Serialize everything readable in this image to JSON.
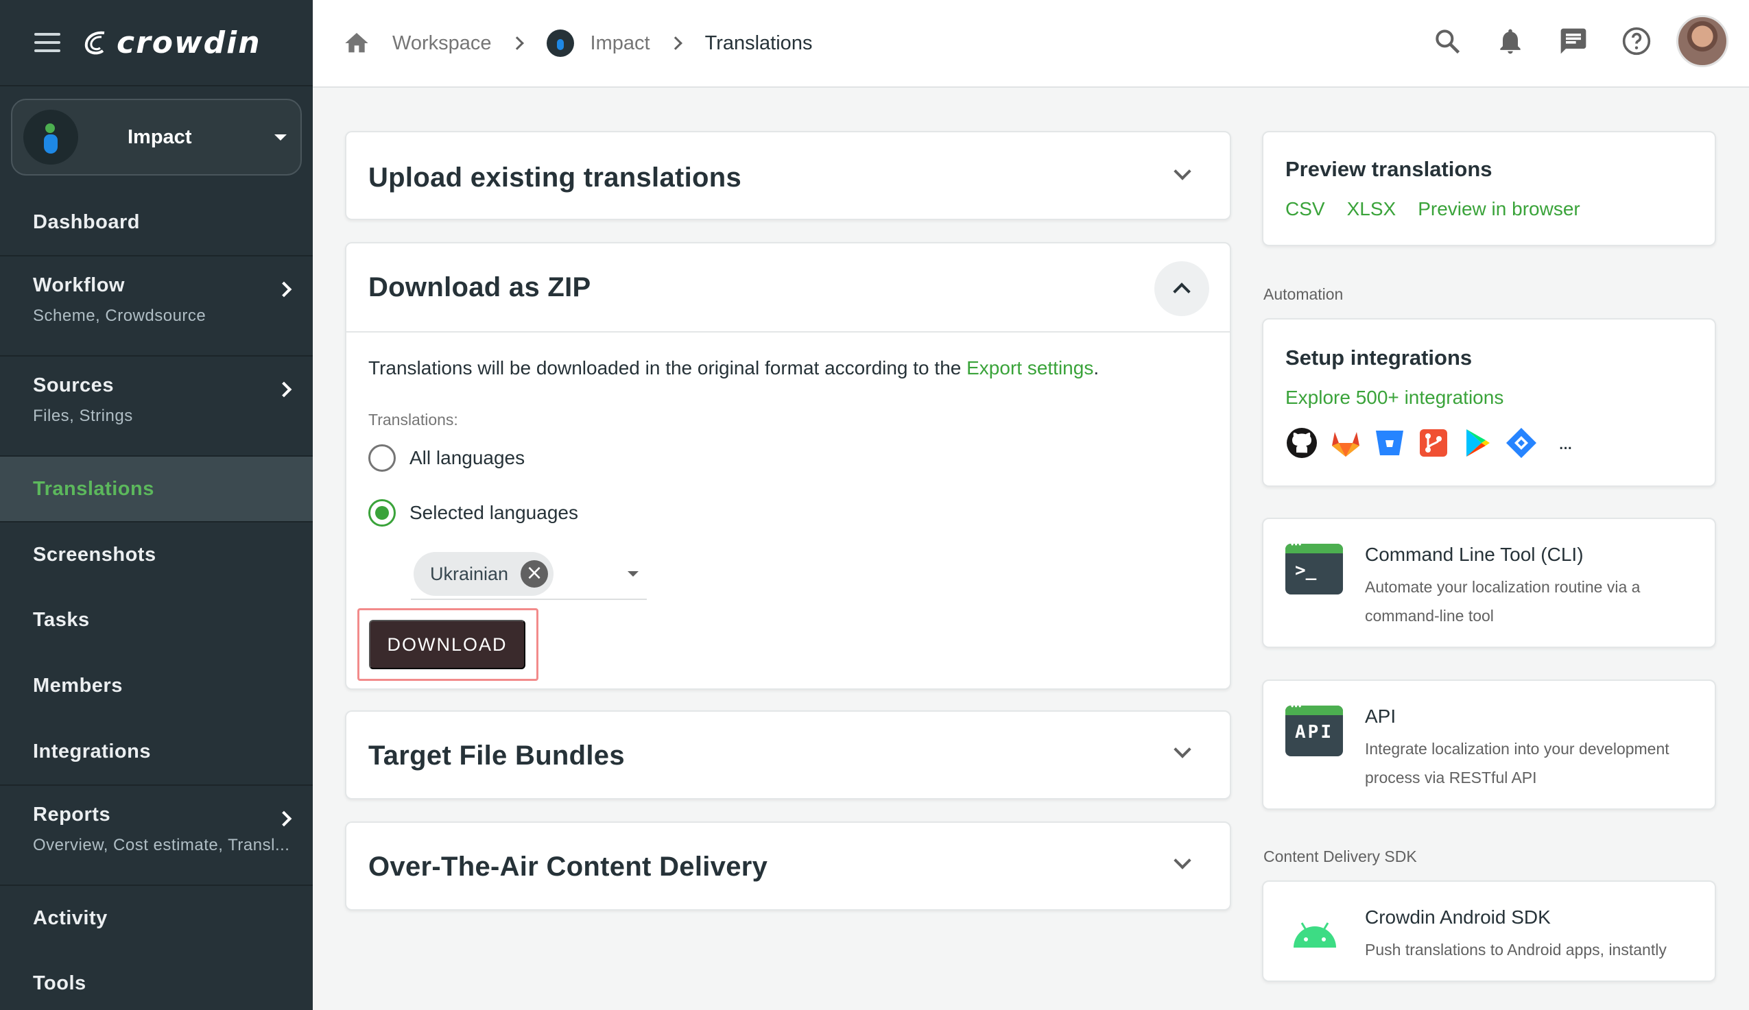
{
  "sidebar": {
    "logo_text": "crowdin",
    "project": {
      "name": "Impact"
    },
    "items": [
      {
        "label": "Dashboard",
        "sub": null
      },
      {
        "label": "Workflow",
        "sub": "Scheme, Crowdsource"
      },
      {
        "label": "Sources",
        "sub": "Files, Strings"
      },
      {
        "label": "Translations",
        "sub": null,
        "active": true
      },
      {
        "label": "Screenshots",
        "sub": null
      },
      {
        "label": "Tasks",
        "sub": null
      },
      {
        "label": "Members",
        "sub": null
      },
      {
        "label": "Integrations",
        "sub": null
      },
      {
        "label": "Reports",
        "sub": "Overview, Cost estimate, Transl..."
      },
      {
        "label": "Activity",
        "sub": null
      },
      {
        "label": "Tools",
        "sub": null
      }
    ]
  },
  "breadcrumb": {
    "workspace": "Workspace",
    "project": "Impact",
    "current": "Translations"
  },
  "topbar": {
    "icons": [
      "search-icon",
      "bell-icon",
      "chat-icon",
      "help-icon",
      "user-avatar"
    ]
  },
  "main": {
    "upload": {
      "title": "Upload existing translations"
    },
    "zip": {
      "title": "Download as ZIP",
      "desc_prefix": "Translations will be downloaded in the original format according to the ",
      "desc_link": "Export settings",
      "desc_suffix": ".",
      "field_label": "Translations:",
      "option_all": "All languages",
      "option_selected": "Selected languages",
      "selected_option": "Selected languages",
      "chip": "Ukrainian",
      "download_label": "DOWNLOAD"
    },
    "bundles": {
      "title": "Target File Bundles"
    },
    "ota": {
      "title": "Over-The-Air Content Delivery"
    }
  },
  "right": {
    "preview": {
      "title": "Preview translations",
      "links": [
        "CSV",
        "XLSX",
        "Preview in browser"
      ]
    },
    "automation_label": "Automation",
    "integrations": {
      "title": "Setup integrations",
      "explore": "Explore 500+ integrations",
      "icons": [
        "github-icon",
        "gitlab-icon",
        "bitbucket-icon",
        "git-icon",
        "google-play-icon",
        "jira-icon"
      ],
      "more": "..."
    },
    "cli": {
      "icon_text": ">_",
      "title": "Command Line Tool (CLI)",
      "desc": "Automate your localization routine via a command-line tool"
    },
    "api": {
      "icon_text": "API",
      "title": "API",
      "desc": "Integrate localization into your development process via RESTful API"
    },
    "sdk_label": "Content Delivery SDK",
    "sdk": {
      "title": "Crowdin Android SDK",
      "desc": "Push translations to Android apps, instantly"
    }
  },
  "colors": {
    "sidebar_bg": "#263238",
    "accent_green": "#3aa33a",
    "download_btn": "#3a2a2c",
    "highlight_border": "#f28b8b"
  }
}
